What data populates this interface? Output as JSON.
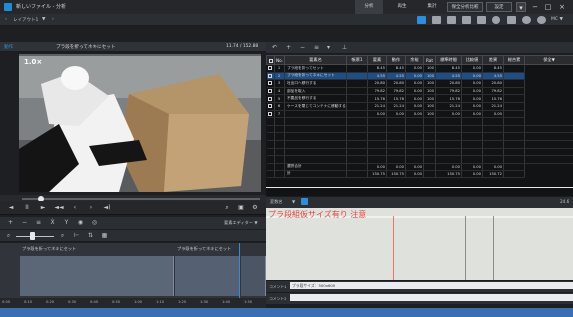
{
  "window": {
    "title": "新しいファイル - 分析",
    "tabs": [
      "分析",
      "再生",
      "集計",
      "保全分析比較",
      "設定"
    ],
    "menu_label": "MC ▼"
  },
  "toolbar": {
    "layout_label": "レイアウト1",
    "prev_label": "‹",
    "play_label": "›"
  },
  "video": {
    "source_label": "動作",
    "clip_title": "プラ段を折ってネキにセット",
    "timecode": "11.74 / 152.88",
    "speed_label": "1.0×"
  },
  "player_controls": [
    "◄",
    "II",
    "►",
    "◄◄",
    "‹",
    "›",
    "◄)"
  ],
  "timeline": {
    "clip_label_1": "プラ段を折ってネキにセット",
    "clip_label_2": "プラ段を折ってネキにセット",
    "right_label": "要素エディター ▼",
    "ruler": [
      "0:00",
      "0:10",
      "0:20",
      "0:30",
      "0:40",
      "0:50",
      "1:00",
      "1:10",
      "1:20",
      "1:30",
      "1:40",
      "1:50"
    ]
  },
  "sheet_toolbar": [
    "↶",
    "+",
    "−",
    "≡",
    "▾",
    "⊥"
  ],
  "sheet": {
    "headers": [
      "",
      "No.",
      "要素名",
      "帳票1",
      "要素",
      "動作",
      "余裕",
      "Rat",
      "標準時間",
      "比較値",
      "差異",
      "総合累",
      "保全▼"
    ],
    "rows": [
      {
        "no": "1",
        "name": "プラ段を折ってセット",
        "cols": [
          "",
          "8.45",
          "8.45",
          "0.00",
          "100",
          "8.45",
          "0.00",
          "8.45",
          ""
        ],
        "selected": false
      },
      {
        "no": "2",
        "name": "プラ段を折ってネキにセット",
        "cols": [
          "",
          "4.55",
          "4.55",
          "0.00",
          "100",
          "4.55",
          "0.00",
          "4.55",
          ""
        ],
        "selected": true
      },
      {
        "no": "3",
        "name": "吐出口へ移行する",
        "cols": [
          "",
          "20.80",
          "20.80",
          "0.00",
          "100",
          "20.80",
          "0.00",
          "20.80",
          ""
        ],
        "selected": false
      },
      {
        "no": "4",
        "name": "部品を取入",
        "cols": [
          "",
          "79.82",
          "79.82",
          "0.00",
          "100",
          "79.82",
          "0.00",
          "79.82",
          ""
        ],
        "selected": false
      },
      {
        "no": "5",
        "name": "不要品を移行する",
        "cols": [
          "",
          "15.76",
          "15.76",
          "0.00",
          "100",
          "15.76",
          "0.00",
          "15.76",
          ""
        ],
        "selected": false
      },
      {
        "no": "6",
        "name": "ケースを閉じてコンテナに移動する",
        "cols": [
          "",
          "21.24",
          "21.24",
          "0.00",
          "100",
          "21.24",
          "0.00",
          "21.24",
          ""
        ],
        "selected": false
      },
      {
        "no": "7",
        "name": "",
        "cols": [
          "",
          "0.00",
          "0.00",
          "0.00",
          "100",
          "0.00",
          "0.00",
          "0.00",
          ""
        ],
        "selected": false
      }
    ],
    "summary": [
      {
        "label": "選択合計",
        "cols": [
          "",
          "0.00",
          "0.00",
          "0.00",
          "",
          "0.00",
          "0.00",
          "0.00",
          ""
        ]
      },
      {
        "label": "計",
        "cols": [
          "",
          "150.75",
          "150.75",
          "0.00",
          "",
          "150.75",
          "0.00",
          "150.72",
          ""
        ]
      }
    ]
  },
  "mid_bar": {
    "label": "変数名",
    "right_value": "24.6"
  },
  "caption": "プラ段組仮サイズ有り 注意",
  "comments": [
    {
      "label": "コメント1",
      "value": "プラ段サイズ：500x600"
    },
    {
      "label": "コメント2",
      "value": ""
    }
  ],
  "colors": {
    "accent_blue": "#2f8ddc",
    "selection": "#1f4e86",
    "caption_red": "#e8453c",
    "status_bar": "#3a6fb4"
  }
}
